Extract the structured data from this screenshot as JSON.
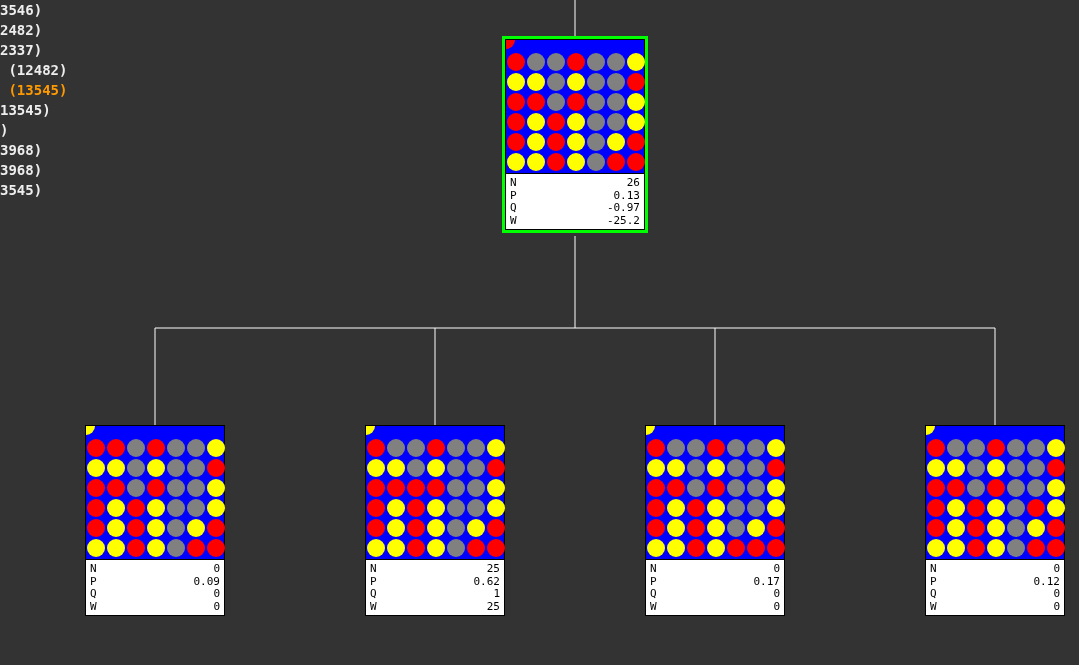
{
  "log": [
    {
      "text": "3546)",
      "highlighted": false
    },
    {
      "text": "2482)",
      "highlighted": false
    },
    {
      "text": "2337)",
      "highlighted": false
    },
    {
      "text": " (12482)",
      "highlighted": false
    },
    {
      "text": " (13545)",
      "highlighted": true
    },
    {
      "text": "13545)",
      "highlighted": false
    },
    {
      "text": ")",
      "highlighted": false
    },
    {
      "text": "3968)",
      "highlighted": false
    },
    {
      "text": "3968)",
      "highlighted": false
    },
    {
      "text": "3545)",
      "highlighted": false
    }
  ],
  "tree": {
    "root": {
      "selected": true,
      "turn_marker": {
        "color": "#ff0000"
      },
      "board": [
        [
          {
            "color": "#ff0000"
          },
          {
            "color": "#808080"
          },
          {
            "color": "#808080"
          },
          {
            "color": "#ff0000"
          },
          {
            "color": "#808080"
          },
          {
            "color": "#808080"
          },
          {
            "color": "#ffff00"
          }
        ],
        [
          {
            "color": "#ffff00"
          },
          {
            "color": "#ffff00"
          },
          {
            "color": "#808080"
          },
          {
            "color": "#ffff00"
          },
          {
            "color": "#808080"
          },
          {
            "color": "#808080"
          },
          {
            "color": "#ff0000"
          }
        ],
        [
          {
            "color": "#ff0000"
          },
          {
            "color": "#ff0000"
          },
          {
            "color": "#808080"
          },
          {
            "color": "#ff0000"
          },
          {
            "color": "#808080"
          },
          {
            "color": "#808080"
          },
          {
            "color": "#ffff00"
          }
        ],
        [
          {
            "color": "#ff0000"
          },
          {
            "color": "#ffff00"
          },
          {
            "color": "#ff0000"
          },
          {
            "color": "#ffff00"
          },
          {
            "color": "#808080"
          },
          {
            "color": "#808080"
          },
          {
            "color": "#ffff00"
          }
        ],
        [
          {
            "color": "#ff0000"
          },
          {
            "color": "#ffff00"
          },
          {
            "color": "#ff0000"
          },
          {
            "color": "#ffff00"
          },
          {
            "color": "#808080"
          },
          {
            "color": "#ffff00"
          },
          {
            "color": "#ff0000"
          }
        ],
        [
          {
            "color": "#ffff00"
          },
          {
            "color": "#ffff00"
          },
          {
            "color": "#ff0000"
          },
          {
            "color": "#ffff00"
          },
          {
            "color": "#808080"
          },
          {
            "color": "#ff0000"
          },
          {
            "color": "#ff0000"
          }
        ]
      ],
      "stats": [
        {
          "label": "N",
          "value": "26"
        },
        {
          "label": "P",
          "value": "0.13"
        },
        {
          "label": "Q",
          "value": "-0.97"
        },
        {
          "label": "W",
          "value": "-25.2"
        }
      ]
    },
    "children": [
      {
        "selected": false,
        "turn_marker": {
          "color": "#ffff00"
        },
        "board": [
          [
            {
              "color": "#ff0000"
            },
            {
              "color": "#ff0000"
            },
            {
              "color": "#808080"
            },
            {
              "color": "#ff0000"
            },
            {
              "color": "#808080"
            },
            {
              "color": "#808080"
            },
            {
              "color": "#ffff00"
            }
          ],
          [
            {
              "color": "#ffff00"
            },
            {
              "color": "#ffff00"
            },
            {
              "color": "#808080"
            },
            {
              "color": "#ffff00"
            },
            {
              "color": "#808080"
            },
            {
              "color": "#808080"
            },
            {
              "color": "#ff0000"
            }
          ],
          [
            {
              "color": "#ff0000"
            },
            {
              "color": "#ff0000"
            },
            {
              "color": "#808080"
            },
            {
              "color": "#ff0000"
            },
            {
              "color": "#808080"
            },
            {
              "color": "#808080"
            },
            {
              "color": "#ffff00"
            }
          ],
          [
            {
              "color": "#ff0000"
            },
            {
              "color": "#ffff00"
            },
            {
              "color": "#ff0000"
            },
            {
              "color": "#ffff00"
            },
            {
              "color": "#808080"
            },
            {
              "color": "#808080"
            },
            {
              "color": "#ffff00"
            }
          ],
          [
            {
              "color": "#ff0000"
            },
            {
              "color": "#ffff00"
            },
            {
              "color": "#ff0000"
            },
            {
              "color": "#ffff00"
            },
            {
              "color": "#808080"
            },
            {
              "color": "#ffff00"
            },
            {
              "color": "#ff0000"
            }
          ],
          [
            {
              "color": "#ffff00"
            },
            {
              "color": "#ffff00"
            },
            {
              "color": "#ff0000"
            },
            {
              "color": "#ffff00"
            },
            {
              "color": "#808080"
            },
            {
              "color": "#ff0000"
            },
            {
              "color": "#ff0000"
            }
          ]
        ],
        "stats": [
          {
            "label": "N",
            "value": "0"
          },
          {
            "label": "P",
            "value": "0.09"
          },
          {
            "label": "Q",
            "value": "0"
          },
          {
            "label": "W",
            "value": "0"
          }
        ]
      },
      {
        "selected": false,
        "turn_marker": {
          "color": "#ffff00"
        },
        "board": [
          [
            {
              "color": "#ff0000"
            },
            {
              "color": "#808080"
            },
            {
              "color": "#808080"
            },
            {
              "color": "#ff0000"
            },
            {
              "color": "#808080"
            },
            {
              "color": "#808080"
            },
            {
              "color": "#ffff00"
            }
          ],
          [
            {
              "color": "#ffff00"
            },
            {
              "color": "#ffff00"
            },
            {
              "color": "#808080"
            },
            {
              "color": "#ffff00"
            },
            {
              "color": "#808080"
            },
            {
              "color": "#808080"
            },
            {
              "color": "#ff0000"
            }
          ],
          [
            {
              "color": "#ff0000"
            },
            {
              "color": "#ff0000"
            },
            {
              "color": "#ff0000"
            },
            {
              "color": "#ff0000"
            },
            {
              "color": "#808080"
            },
            {
              "color": "#808080"
            },
            {
              "color": "#ffff00"
            }
          ],
          [
            {
              "color": "#ff0000"
            },
            {
              "color": "#ffff00"
            },
            {
              "color": "#ff0000"
            },
            {
              "color": "#ffff00"
            },
            {
              "color": "#808080"
            },
            {
              "color": "#808080"
            },
            {
              "color": "#ffff00"
            }
          ],
          [
            {
              "color": "#ff0000"
            },
            {
              "color": "#ffff00"
            },
            {
              "color": "#ff0000"
            },
            {
              "color": "#ffff00"
            },
            {
              "color": "#808080"
            },
            {
              "color": "#ffff00"
            },
            {
              "color": "#ff0000"
            }
          ],
          [
            {
              "color": "#ffff00"
            },
            {
              "color": "#ffff00"
            },
            {
              "color": "#ff0000"
            },
            {
              "color": "#ffff00"
            },
            {
              "color": "#808080"
            },
            {
              "color": "#ff0000"
            },
            {
              "color": "#ff0000"
            }
          ]
        ],
        "stats": [
          {
            "label": "N",
            "value": "25"
          },
          {
            "label": "P",
            "value": "0.62"
          },
          {
            "label": "Q",
            "value": "1"
          },
          {
            "label": "W",
            "value": "25"
          }
        ]
      },
      {
        "selected": false,
        "turn_marker": {
          "color": "#ffff00"
        },
        "board": [
          [
            {
              "color": "#ff0000"
            },
            {
              "color": "#808080"
            },
            {
              "color": "#808080"
            },
            {
              "color": "#ff0000"
            },
            {
              "color": "#808080"
            },
            {
              "color": "#808080"
            },
            {
              "color": "#ffff00"
            }
          ],
          [
            {
              "color": "#ffff00"
            },
            {
              "color": "#ffff00"
            },
            {
              "color": "#808080"
            },
            {
              "color": "#ffff00"
            },
            {
              "color": "#808080"
            },
            {
              "color": "#808080"
            },
            {
              "color": "#ff0000"
            }
          ],
          [
            {
              "color": "#ff0000"
            },
            {
              "color": "#ff0000"
            },
            {
              "color": "#808080"
            },
            {
              "color": "#ff0000"
            },
            {
              "color": "#808080"
            },
            {
              "color": "#808080"
            },
            {
              "color": "#ffff00"
            }
          ],
          [
            {
              "color": "#ff0000"
            },
            {
              "color": "#ffff00"
            },
            {
              "color": "#ff0000"
            },
            {
              "color": "#ffff00"
            },
            {
              "color": "#808080"
            },
            {
              "color": "#808080"
            },
            {
              "color": "#ffff00"
            }
          ],
          [
            {
              "color": "#ff0000"
            },
            {
              "color": "#ffff00"
            },
            {
              "color": "#ff0000"
            },
            {
              "color": "#ffff00"
            },
            {
              "color": "#808080"
            },
            {
              "color": "#ffff00"
            },
            {
              "color": "#ff0000"
            }
          ],
          [
            {
              "color": "#ffff00"
            },
            {
              "color": "#ffff00"
            },
            {
              "color": "#ff0000"
            },
            {
              "color": "#ffff00"
            },
            {
              "color": "#ff0000"
            },
            {
              "color": "#ff0000"
            },
            {
              "color": "#ff0000"
            }
          ]
        ],
        "stats": [
          {
            "label": "N",
            "value": "0"
          },
          {
            "label": "P",
            "value": "0.17"
          },
          {
            "label": "Q",
            "value": "0"
          },
          {
            "label": "W",
            "value": "0"
          }
        ]
      },
      {
        "selected": false,
        "turn_marker": {
          "color": "#ffff00"
        },
        "board": [
          [
            {
              "color": "#ff0000"
            },
            {
              "color": "#808080"
            },
            {
              "color": "#808080"
            },
            {
              "color": "#ff0000"
            },
            {
              "color": "#808080"
            },
            {
              "color": "#808080"
            },
            {
              "color": "#ffff00"
            }
          ],
          [
            {
              "color": "#ffff00"
            },
            {
              "color": "#ffff00"
            },
            {
              "color": "#808080"
            },
            {
              "color": "#ffff00"
            },
            {
              "color": "#808080"
            },
            {
              "color": "#808080"
            },
            {
              "color": "#ff0000"
            }
          ],
          [
            {
              "color": "#ff0000"
            },
            {
              "color": "#ff0000"
            },
            {
              "color": "#808080"
            },
            {
              "color": "#ff0000"
            },
            {
              "color": "#808080"
            },
            {
              "color": "#808080"
            },
            {
              "color": "#ffff00"
            }
          ],
          [
            {
              "color": "#ff0000"
            },
            {
              "color": "#ffff00"
            },
            {
              "color": "#ff0000"
            },
            {
              "color": "#ffff00"
            },
            {
              "color": "#808080"
            },
            {
              "color": "#ff0000"
            },
            {
              "color": "#ffff00"
            }
          ],
          [
            {
              "color": "#ff0000"
            },
            {
              "color": "#ffff00"
            },
            {
              "color": "#ff0000"
            },
            {
              "color": "#ffff00"
            },
            {
              "color": "#808080"
            },
            {
              "color": "#ffff00"
            },
            {
              "color": "#ff0000"
            }
          ],
          [
            {
              "color": "#ffff00"
            },
            {
              "color": "#ffff00"
            },
            {
              "color": "#ff0000"
            },
            {
              "color": "#ffff00"
            },
            {
              "color": "#808080"
            },
            {
              "color": "#ff0000"
            },
            {
              "color": "#ff0000"
            }
          ]
        ],
        "stats": [
          {
            "label": "N",
            "value": "0"
          },
          {
            "label": "P",
            "value": "0.12"
          },
          {
            "label": "Q",
            "value": "0"
          },
          {
            "label": "W",
            "value": "0"
          }
        ]
      }
    ]
  }
}
